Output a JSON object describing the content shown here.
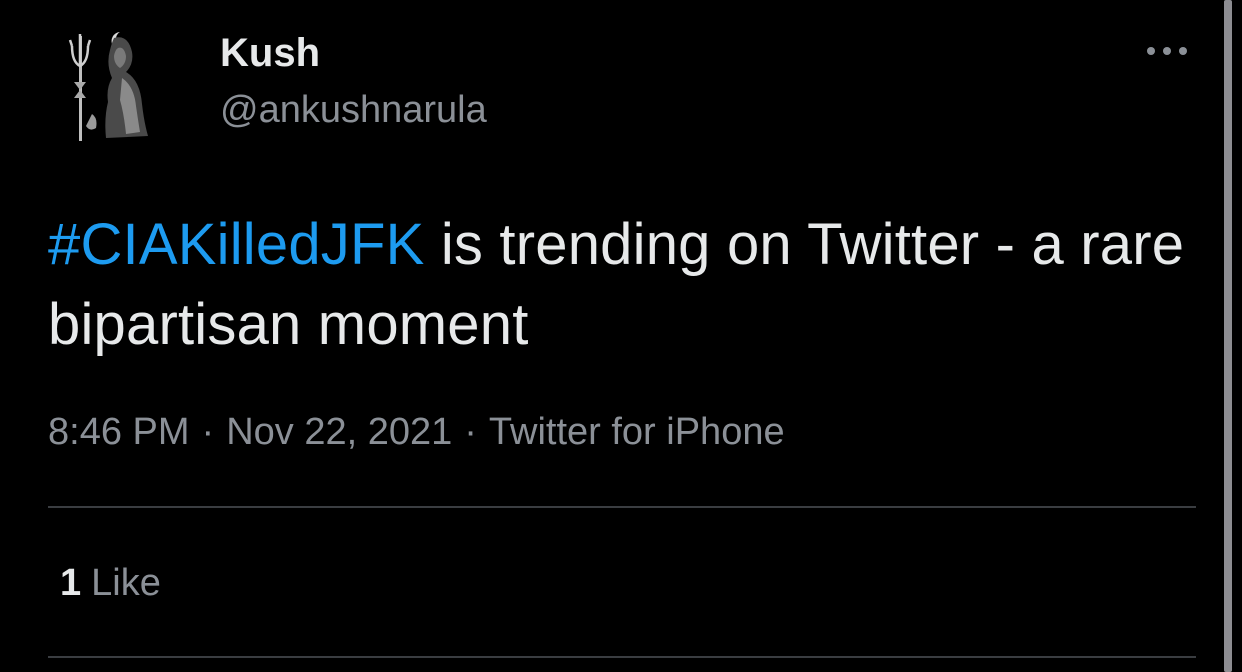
{
  "tweet": {
    "author": {
      "display_name": "Kush",
      "handle": "@ankushnarula",
      "avatar_icon": "shiva-trident-silhouette-avatar"
    },
    "more_icon": "more-horizontal-icon",
    "text": {
      "hashtag": "#CIAKilledJFK",
      "body": " is trending on Twitter - a rare bipartisan moment"
    },
    "meta": {
      "time": "8:46 PM",
      "separator": "·",
      "date": "Nov 22, 2021",
      "source": "Twitter for iPhone"
    },
    "stats": {
      "likes_count": "1",
      "likes_label": "Like"
    }
  },
  "colors": {
    "background": "#000000",
    "text_primary": "#e7e9ea",
    "text_secondary": "#8b9097",
    "hashtag": "#1d9bf0",
    "divider": "#3a3d41"
  }
}
